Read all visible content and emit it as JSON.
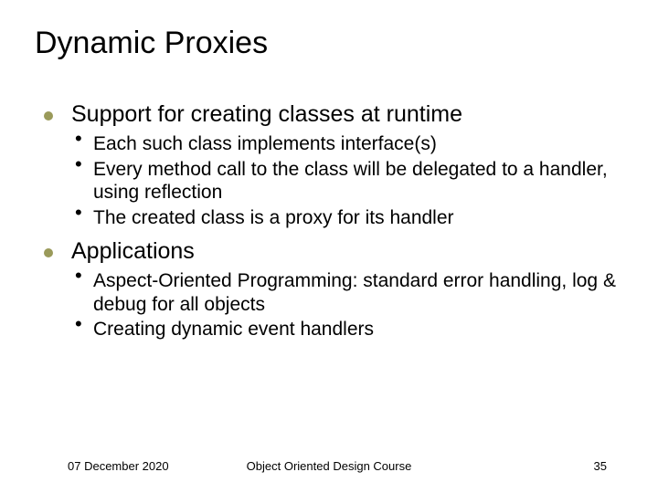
{
  "title": "Dynamic Proxies",
  "items": [
    {
      "text": "Support for creating classes at runtime",
      "sub": [
        "Each such class implements interface(s)",
        "Every method call to the class will be delegated to a handler, using reflection",
        "The created class is a proxy for its handler"
      ]
    },
    {
      "text": "Applications",
      "sub": [
        "Aspect-Oriented Programming: standard error handling, log & debug for all objects",
        "Creating dynamic event handlers"
      ]
    }
  ],
  "footer": {
    "date": "07 December 2020",
    "center": "Object Oriented Design Course",
    "num": "35"
  }
}
